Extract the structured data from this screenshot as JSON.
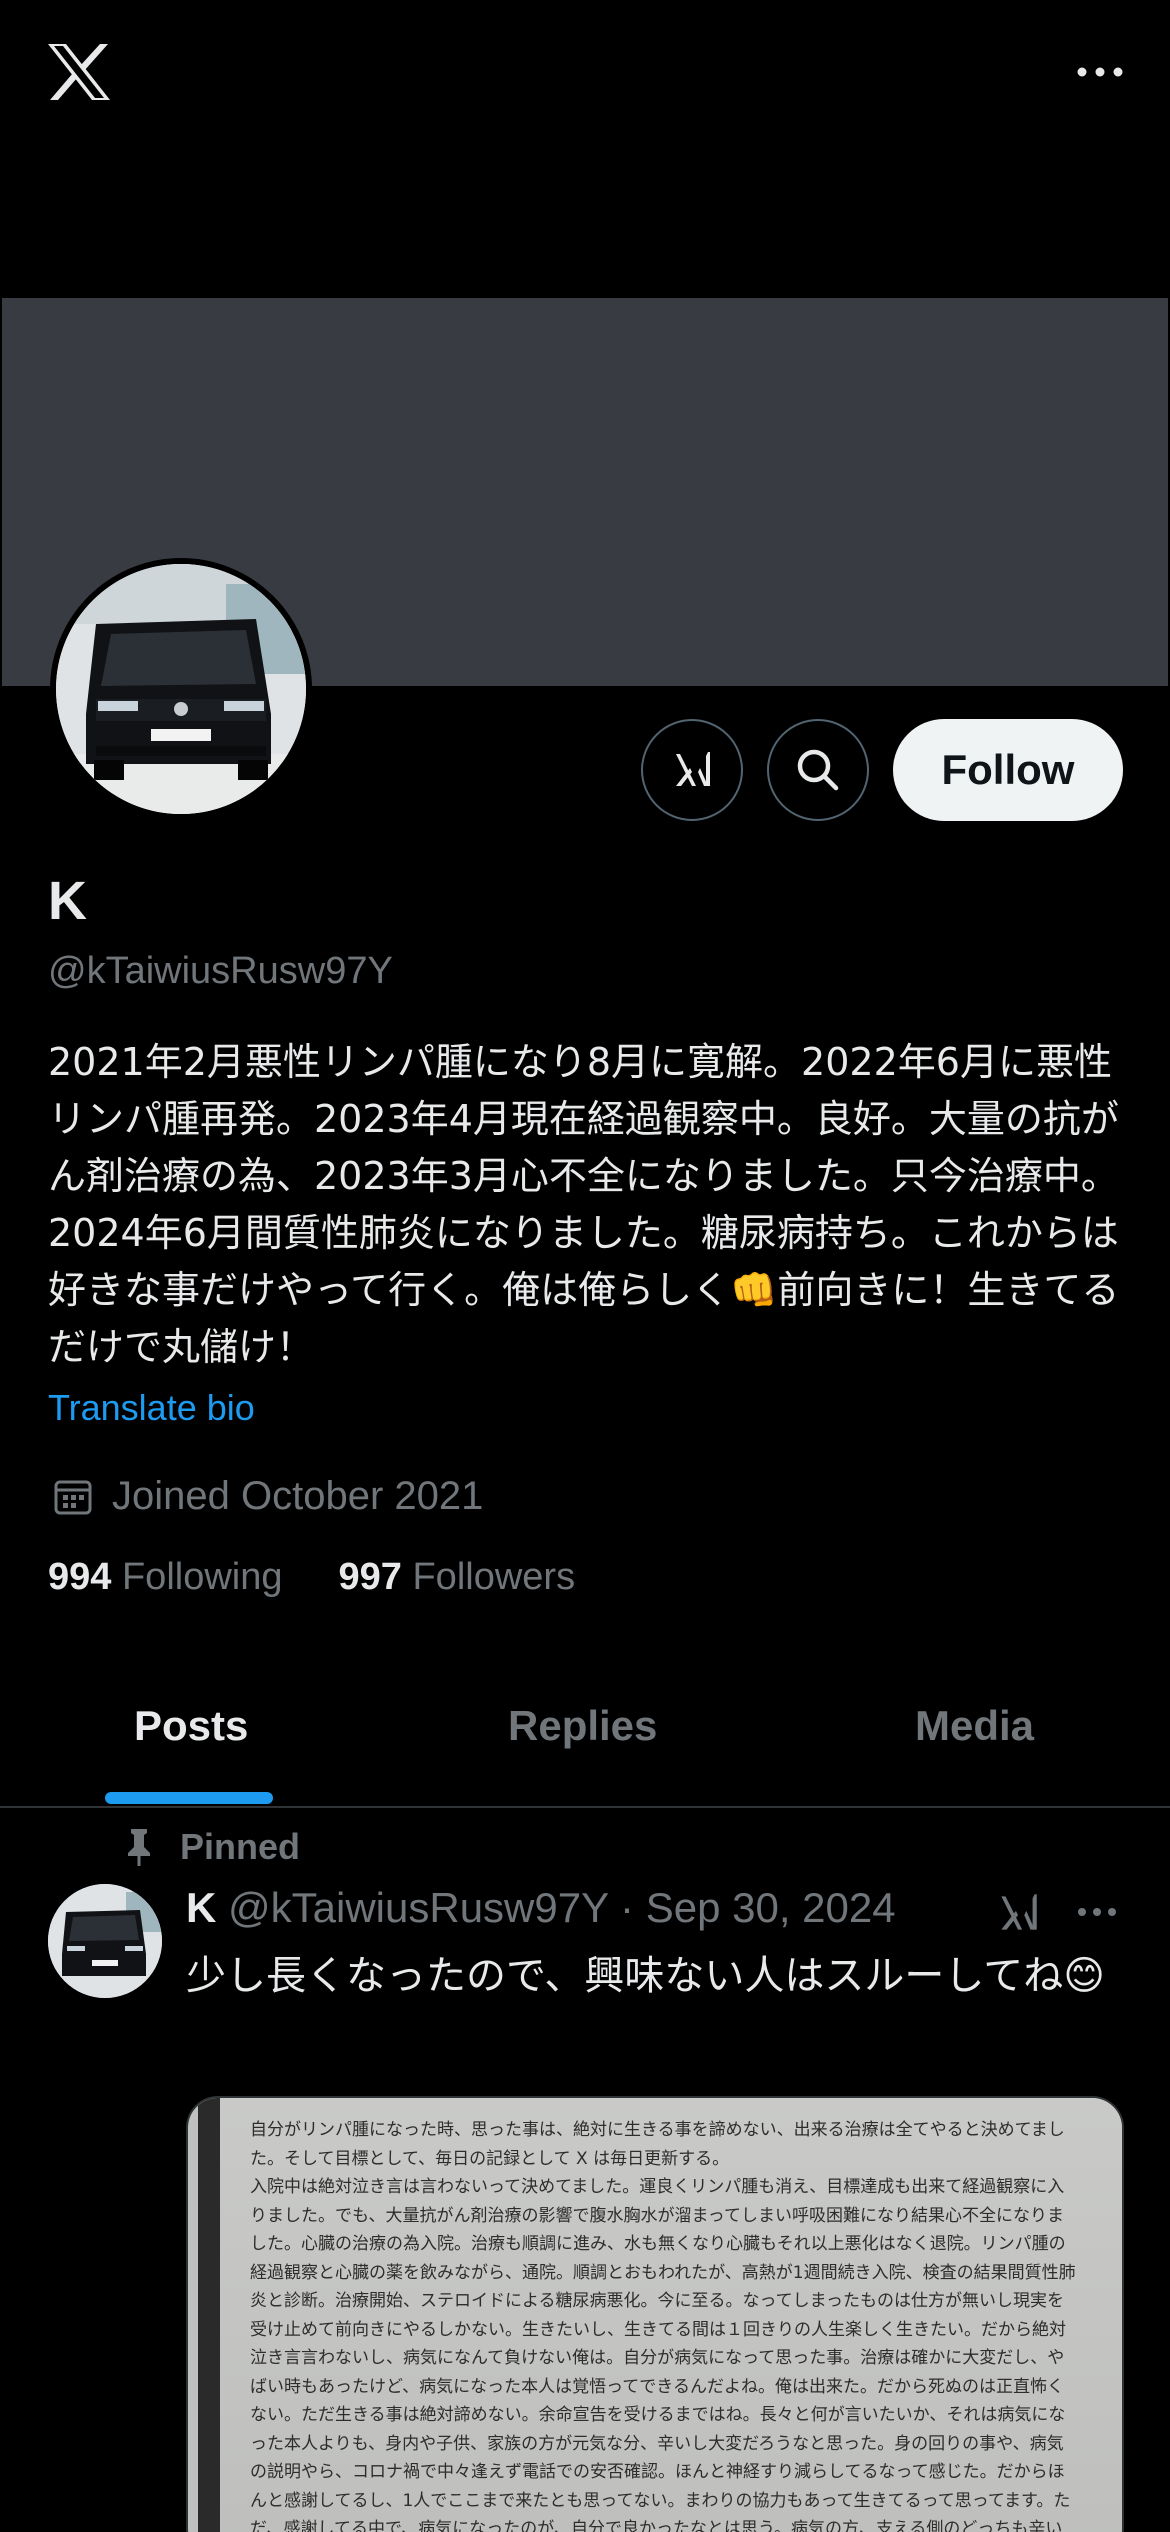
{
  "profile": {
    "display_name": "K",
    "handle": "@kTaiwiusRusw97Y",
    "bio": "2021年2月悪性リンパ腫になり8月に寛解。2022年6月に悪性リンパ腫再発。2023年4月現在経過観察中。良好。大量の抗がん剤治療の為、2023年3月心不全になりました。只今治療中。2024年6月間質性肺炎になりました。糖尿病持ち。これからは好きな事だけやって行く。俺は俺らしく👊前向きに！生きてるだけで丸儲け！",
    "translate_label": "Translate bio",
    "joined": "Joined October 2021",
    "following_count": "994",
    "following_label": "Following",
    "followers_count": "997",
    "followers_label": "Followers"
  },
  "actions": {
    "follow_label": "Follow",
    "grok_icon": "grok-icon",
    "search_icon": "search-icon"
  },
  "header": {
    "logo_icon": "x-logo-icon",
    "more_icon": "more-horizontal-icon"
  },
  "tabs": [
    {
      "label": "Posts",
      "active": true
    },
    {
      "label": "Replies",
      "active": false
    },
    {
      "label": "Media",
      "active": false
    }
  ],
  "pinned_post": {
    "pinned_label": "Pinned",
    "author_name": "K",
    "author_handle": "@kTaiwiusRusw97Y",
    "separator": "·",
    "date": "Sep 30, 2024",
    "text": "少し長くなったので、興味ない人はスルーしてね😊",
    "image_text_lines": [
      "自分がリンパ腫になった時、思った事は、絶対に生きる事を諦めない、出来る治療は全てやると決めてまし",
      "た。そして目標として、毎日の記録として X は毎日更新する。",
      "入院中は絶対泣き言は言わないって決めてました。運良くリンパ腫も消え、目標達成も出来て経過観察に入",
      "りました。でも、大量抗がん剤治療の影響で腹水胸水が溜まってしまい呼吸困難になり結果心不全になりま",
      "した。心臓の治療の為入院。治療も順調に進み、水も無くなり心臓もそれ以上悪化はなく退院。リンパ腫の",
      "経過観察と心臓の薬を飲みながら、通院。順調とおもわれたが、高熱が1週間続き入院、検査の結果間質性肺",
      "炎と診断。治療開始、ステロイドによる糖尿病悪化。今に至る。なってしまったものは仕方が無いし現実を",
      "受け止めて前向きにやるしかない。生きたいし、生きてる間は１回きりの人生楽しく生きたい。だから絶対",
      "泣き言言わないし、病気になんて負けない俺は。自分が病気になって思った事。治療は確かに大変だし、や",
      "ばい時もあったけど、病気になった本人は覚悟ってできるんだよね。俺は出来た。だから死ぬのは正直怖く",
      "ない。ただ生きる事は絶対諦めない。余命宣告を受けるまではね。長々と何が言いたいか、それは病気にな",
      "った本人よりも、身内や子供、家族の方が元気な分、辛いし大変だろうなと思った。身の回りの事や、病気",
      "の説明やら、コロナ禍で中々逢えず電話での安否確認。ほんと神経すり減らしてるなって感じた。だからほ",
      "んと感謝してるし、1人でここまで来たとも思ってない。まわりの協力もあって生きてるって思ってます。た",
      "だ、感謝してる中で、病気になったのが、自分で良かったなとは思う。病気の方、支える側のどっちも辛い"
    ]
  }
}
